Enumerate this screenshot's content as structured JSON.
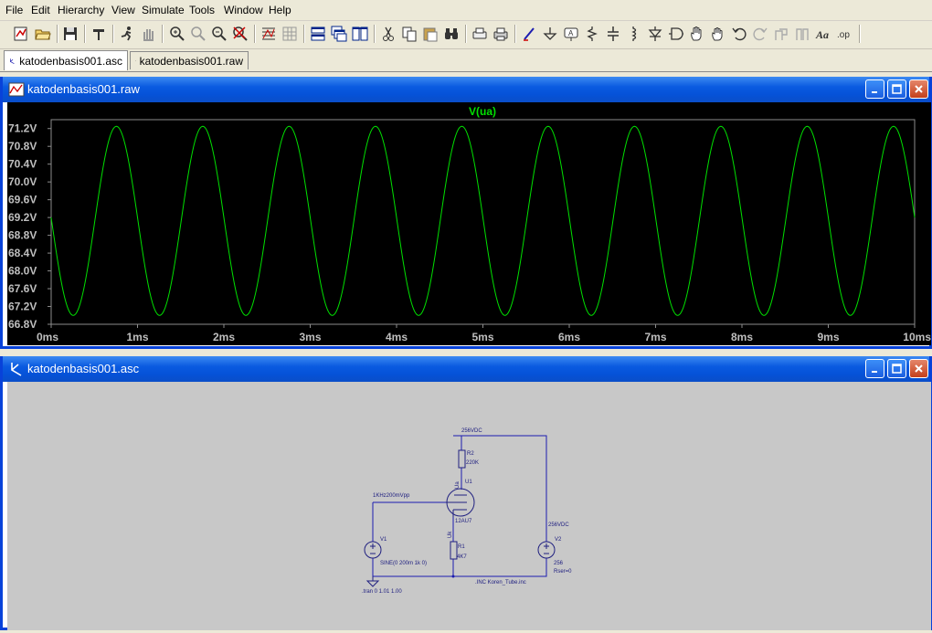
{
  "menu": [
    "File",
    "Edit",
    "Hierarchy",
    "View",
    "Simulate",
    "Tools",
    "Window",
    "Help"
  ],
  "toolbar": {
    "icons": [
      "new-schematic-icon",
      "open-icon",
      "save-icon",
      "control-panel-icon",
      "run-icon",
      "halt-icon",
      "zoom-in-icon",
      "zoom-pan-icon",
      "zoom-out-icon",
      "zoom-cancel-icon",
      "autorange-icon",
      "grid-icon",
      "tile-horizontal-icon",
      "cascade-icon",
      "tile-vertical-icon",
      "cut-icon",
      "copy-icon",
      "paste-icon",
      "find-icon",
      "print-preview-icon",
      "print-icon",
      "wire-icon",
      "ground-icon",
      "label-icon",
      "resistor-icon",
      "capacitor-icon",
      "inductor-icon",
      "diode-icon",
      "component-icon",
      "move-icon",
      "drag-icon",
      "undo-icon",
      "redo-icon",
      "rotate-icon",
      "mirror-icon",
      "text-icon",
      "spice-directive-icon"
    ]
  },
  "tabs": [
    {
      "label": "katodenbasis001.asc",
      "icon": "schematic-icon",
      "active": true
    },
    {
      "label": "katodenbasis001.raw",
      "icon": "waveform-icon",
      "active": false
    }
  ],
  "plot_window": {
    "title": "katodenbasis001.raw"
  },
  "schematic_window": {
    "title": "katodenbasis001.asc"
  },
  "colors": {
    "trace": "#00e000",
    "plot_bg": "#000000",
    "axis": "#bfbfbf",
    "wire": "#1c1cb0",
    "schematic_bg": "#c8c8c8",
    "title_blue": "#0a5ae0"
  },
  "chart_data": {
    "type": "line",
    "title": "V(ua)",
    "series": [
      {
        "name": "V(ua)",
        "frequency_hz": 1000,
        "min": 67.0,
        "max": 71.25,
        "start_value": 69.2,
        "phase": "falling at t=0"
      }
    ],
    "x_ticks": [
      "0ms",
      "1ms",
      "2ms",
      "3ms",
      "4ms",
      "5ms",
      "6ms",
      "7ms",
      "8ms",
      "9ms",
      "10ms"
    ],
    "y_ticks": [
      "71.2V",
      "70.8V",
      "70.4V",
      "70.0V",
      "69.6V",
      "69.2V",
      "68.8V",
      "68.4V",
      "68.0V",
      "67.6V",
      "67.2V",
      "66.8V"
    ],
    "xlim": [
      0,
      10
    ],
    "ylim": [
      66.8,
      71.4
    ],
    "x_unit": "ms",
    "grid": false
  },
  "schematic": {
    "labels": {
      "supply_top": "256VDC",
      "r2_name": "R2",
      "r2_value": "220K",
      "tube_name": "U1",
      "tube_net": "Ua",
      "tube_model": "12AU7",
      "v1_label": "1KHz200mVpp",
      "v1_name": "V1",
      "v1_value": "SINE(0 200m 1k 0)",
      "uk_net": "Uk",
      "r1_name": "R1",
      "r1_value": "4K7",
      "v2_label": "256VDC",
      "v2_name": "V2",
      "v2_value": "256",
      "v2_rser": "Rser=0",
      "tran_cmd": ".tran 0 1.01 1.00",
      "include_cmd": ".INC Koren_Tube.inc"
    }
  }
}
